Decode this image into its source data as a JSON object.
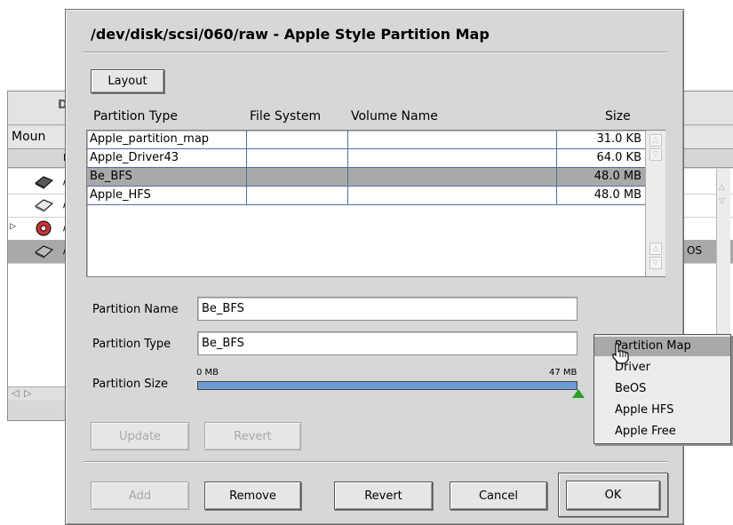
{
  "background_window": {
    "title": "D",
    "tab_label": "Moun",
    "header_label": "D",
    "rows": [
      {
        "label": "/"
      },
      {
        "label": "/"
      },
      {
        "label": "/"
      },
      {
        "label": "/"
      }
    ],
    "side_text": "OS"
  },
  "dialog": {
    "title": "/dev/disk/scsi/060/raw - Apple Style Partition Map",
    "layout_button": "Layout",
    "columns": {
      "partition_type": "Partition Type",
      "file_system": "File System",
      "volume_name": "Volume Name",
      "size": "Size"
    },
    "partitions": [
      {
        "type": "Apple_partition_map",
        "file_system": "",
        "volume_name": "",
        "size": "31.0 KB"
      },
      {
        "type": "Apple_Driver43",
        "file_system": "",
        "volume_name": "",
        "size": "64.0 KB"
      },
      {
        "type": "Be_BFS",
        "file_system": "",
        "volume_name": "",
        "size": "48.0 MB"
      },
      {
        "type": "Apple_HFS",
        "file_system": "",
        "volume_name": "",
        "size": "48.0 MB"
      }
    ],
    "selected_partition_index": 2,
    "partition_name_label": "Partition Name",
    "partition_name_value": "Be_BFS",
    "partition_type_label": "Partition Type",
    "partition_type_value": "Be_BFS",
    "partition_size_label": "Partition Size",
    "size_min_label": "0 MB",
    "size_max_label": "47 MB",
    "size_fraction": 1.0,
    "update_button": "Update",
    "revert_button": "Revert",
    "add_button": "Add",
    "remove_button": "Remove",
    "revert2_button": "Revert",
    "cancel_button": "Cancel",
    "ok_button": "OK"
  },
  "popup_menu": {
    "items": [
      "Partition Map",
      "Driver",
      "BeOS",
      "Apple HFS",
      "Apple Free"
    ],
    "highlighted_index": 0
  },
  "colors": {
    "dialog_bg": "#d7d7d7",
    "selection": "#a9a9a9",
    "slider_fill": "#6f9cd6",
    "slider_thumb": "#27a227",
    "grid_line": "#4f6fa8"
  }
}
